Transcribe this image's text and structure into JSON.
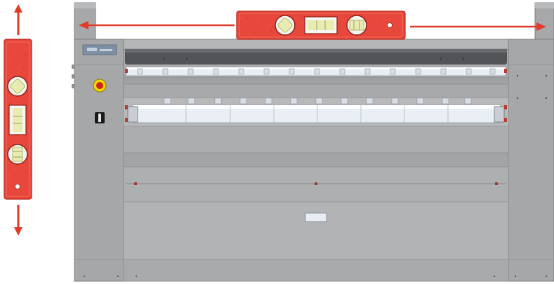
{
  "colors": {
    "background": "#ffffff",
    "machine_body": "#a9aaac",
    "machine_dark": "#8f9093",
    "machine_light": "#c2c3c5",
    "roller_fill": "#e9eef4",
    "level_red": "#e8483b",
    "level_red_dark": "#b52a20",
    "vial_yellow": "#e9ecb0",
    "arrow_red": "#e23a2a",
    "stop_button_red": "#d4201a",
    "stop_button_yellow": "#f2d800"
  },
  "icons": {
    "vertical_arrows": "up-down-arrows",
    "horizontal_arrows": "left-right-arrows",
    "emergency_stop": "red-mushroom-button-on-yellow",
    "main_switch": "black-rotary-switch"
  }
}
